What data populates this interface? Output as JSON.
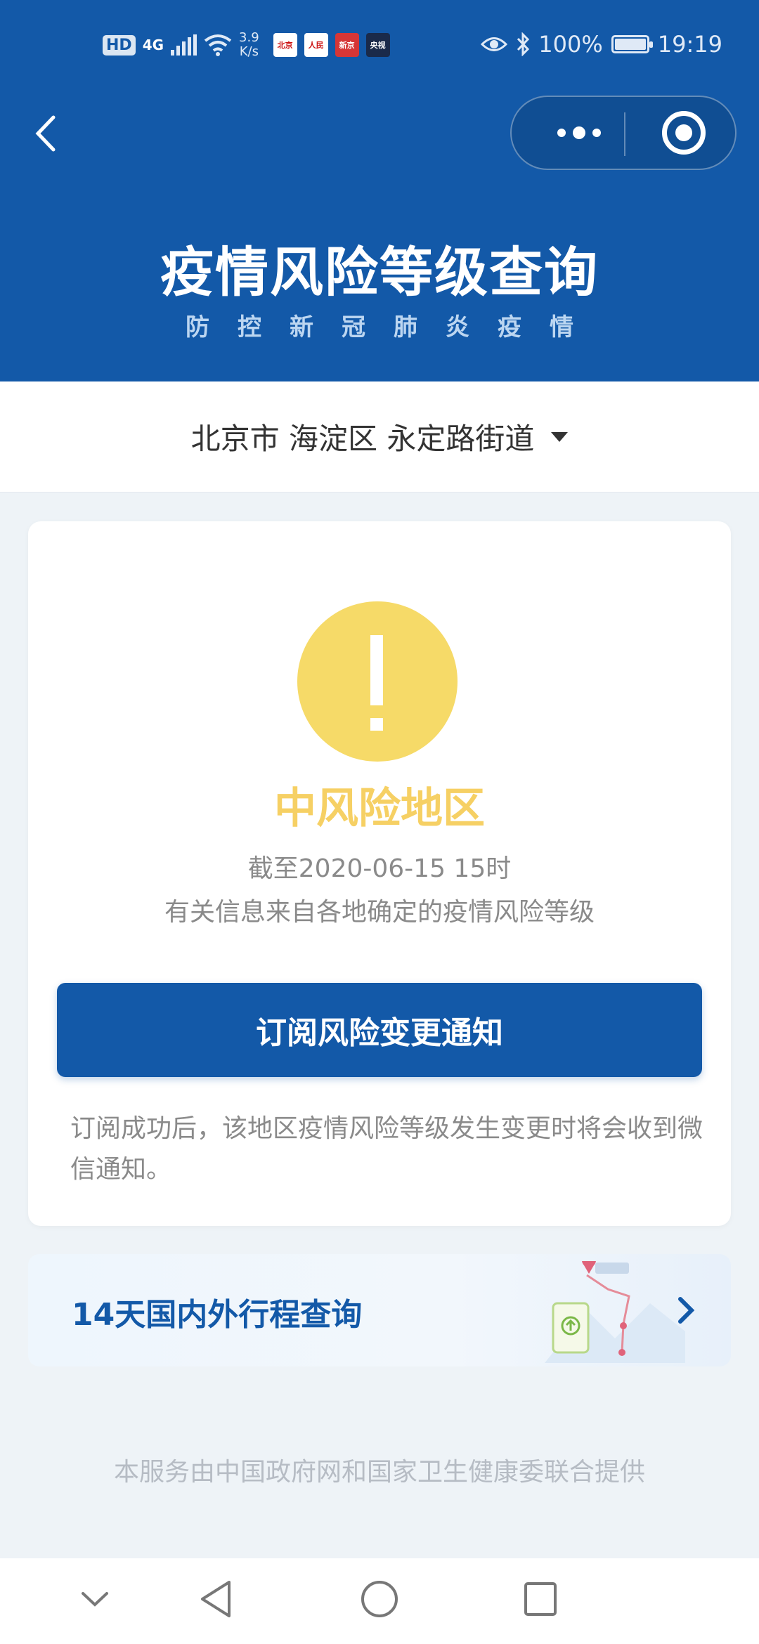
{
  "status_bar": {
    "hd_label": "HD",
    "network": "4G",
    "speed_value": "3.9",
    "speed_unit": "K/s",
    "notification_apps": [
      {
        "name": "北京日报",
        "icon": "app-beijing-daily-icon"
      },
      {
        "name": "人民日报",
        "icon": "app-peoples-daily-icon"
      },
      {
        "name": "新京报",
        "icon": "app-new-beijing-icon"
      },
      {
        "name": "央视新闻",
        "icon": "app-cctv-news-icon"
      }
    ],
    "battery": "100%",
    "time": "19:19"
  },
  "header": {
    "title": "疫情风险等级查询",
    "subtitle": "防控新冠肺炎疫情",
    "bg_color": "#1359a8"
  },
  "location": {
    "label": "北京市 海淀区 永定路街道"
  },
  "risk_card": {
    "level": "中风险地区",
    "level_color": "#f6d064",
    "as_of": "截至2020-06-15 15时",
    "source_note": "有关信息来自各地确定的疫情风险等级",
    "subscribe_button": "订阅风险变更通知",
    "subscribe_note": "订阅成功后，该地区疫情风险等级发生变更时将会收到微信通知。"
  },
  "trip_card": {
    "label": "14天国内外行程查询"
  },
  "footer": {
    "text": "本服务由中国政府网和国家卫生健康委联合提供"
  }
}
